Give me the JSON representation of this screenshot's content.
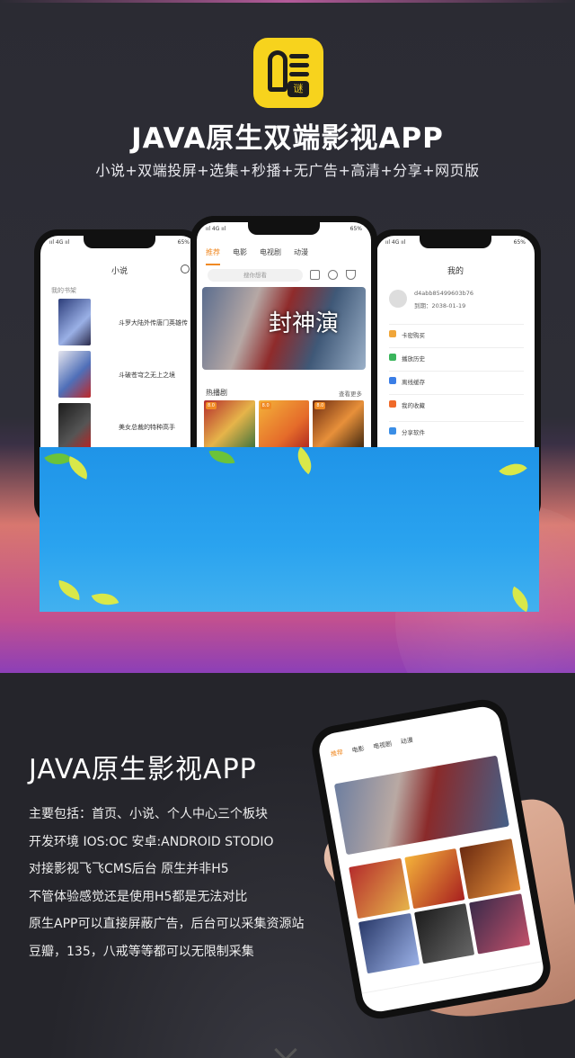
{
  "hero": {
    "title": "JAVA原生双端影视APP",
    "subtitle": "小说+双端投屏+选集+秒播+无广告+高清+分享+网页版",
    "logo_seal": "谜"
  },
  "phone_left": {
    "status_left": "ııl 4G ııl",
    "status_right": "65%",
    "title": "小说",
    "section": "我的书架",
    "books": [
      {
        "name": "斗罗大陆外传唐门英雄传"
      },
      {
        "name": "斗破苍穹之无上之境"
      },
      {
        "name": "美女总裁的特种高手"
      }
    ]
  },
  "phone_mid": {
    "status_left": "ııl 4G ııl",
    "status_right": "65%",
    "tabs": [
      "推荐",
      "电影",
      "电视剧",
      "动漫"
    ],
    "search_placeholder": "搜你想看",
    "banner_text": "封神演",
    "hot_label": "热播剧",
    "more_label": "查看更多",
    "poster_badges": [
      "8.0",
      "8.0",
      "8.0"
    ]
  },
  "phone_right": {
    "status_left": "ııl 4G ııl",
    "status_right": "65%",
    "title": "我的",
    "user_id": "d4abb85499603b76",
    "expire": "到期：2038-01-19",
    "menu": [
      "卡密购买",
      "播放历史",
      "离线缓存",
      "我的收藏",
      "分享软件"
    ]
  },
  "bottom": {
    "title": "JAVA原生影视APP",
    "lines": [
      "主要包括：首页、小说、个人中心三个板块",
      "开发环境 IOS:OC  安卓:ANDROID STODIO",
      "对接影视飞飞CMS后台 原生并非H5",
      "不管体验感觉还是使用H5都是无法对比",
      "原生APP可以直接屏蔽广告，后台可以采集资源站",
      "豆瓣，135，八戒等等都可以无限制采集"
    ]
  },
  "hand_phone": {
    "tabs": [
      "电影",
      "电视剧",
      "动漫"
    ],
    "active_tab": "推荐"
  },
  "colors": {
    "accent": "#f08a24",
    "logo_yellow": "#f7d31d",
    "sky_blue": "#1f94e8"
  }
}
